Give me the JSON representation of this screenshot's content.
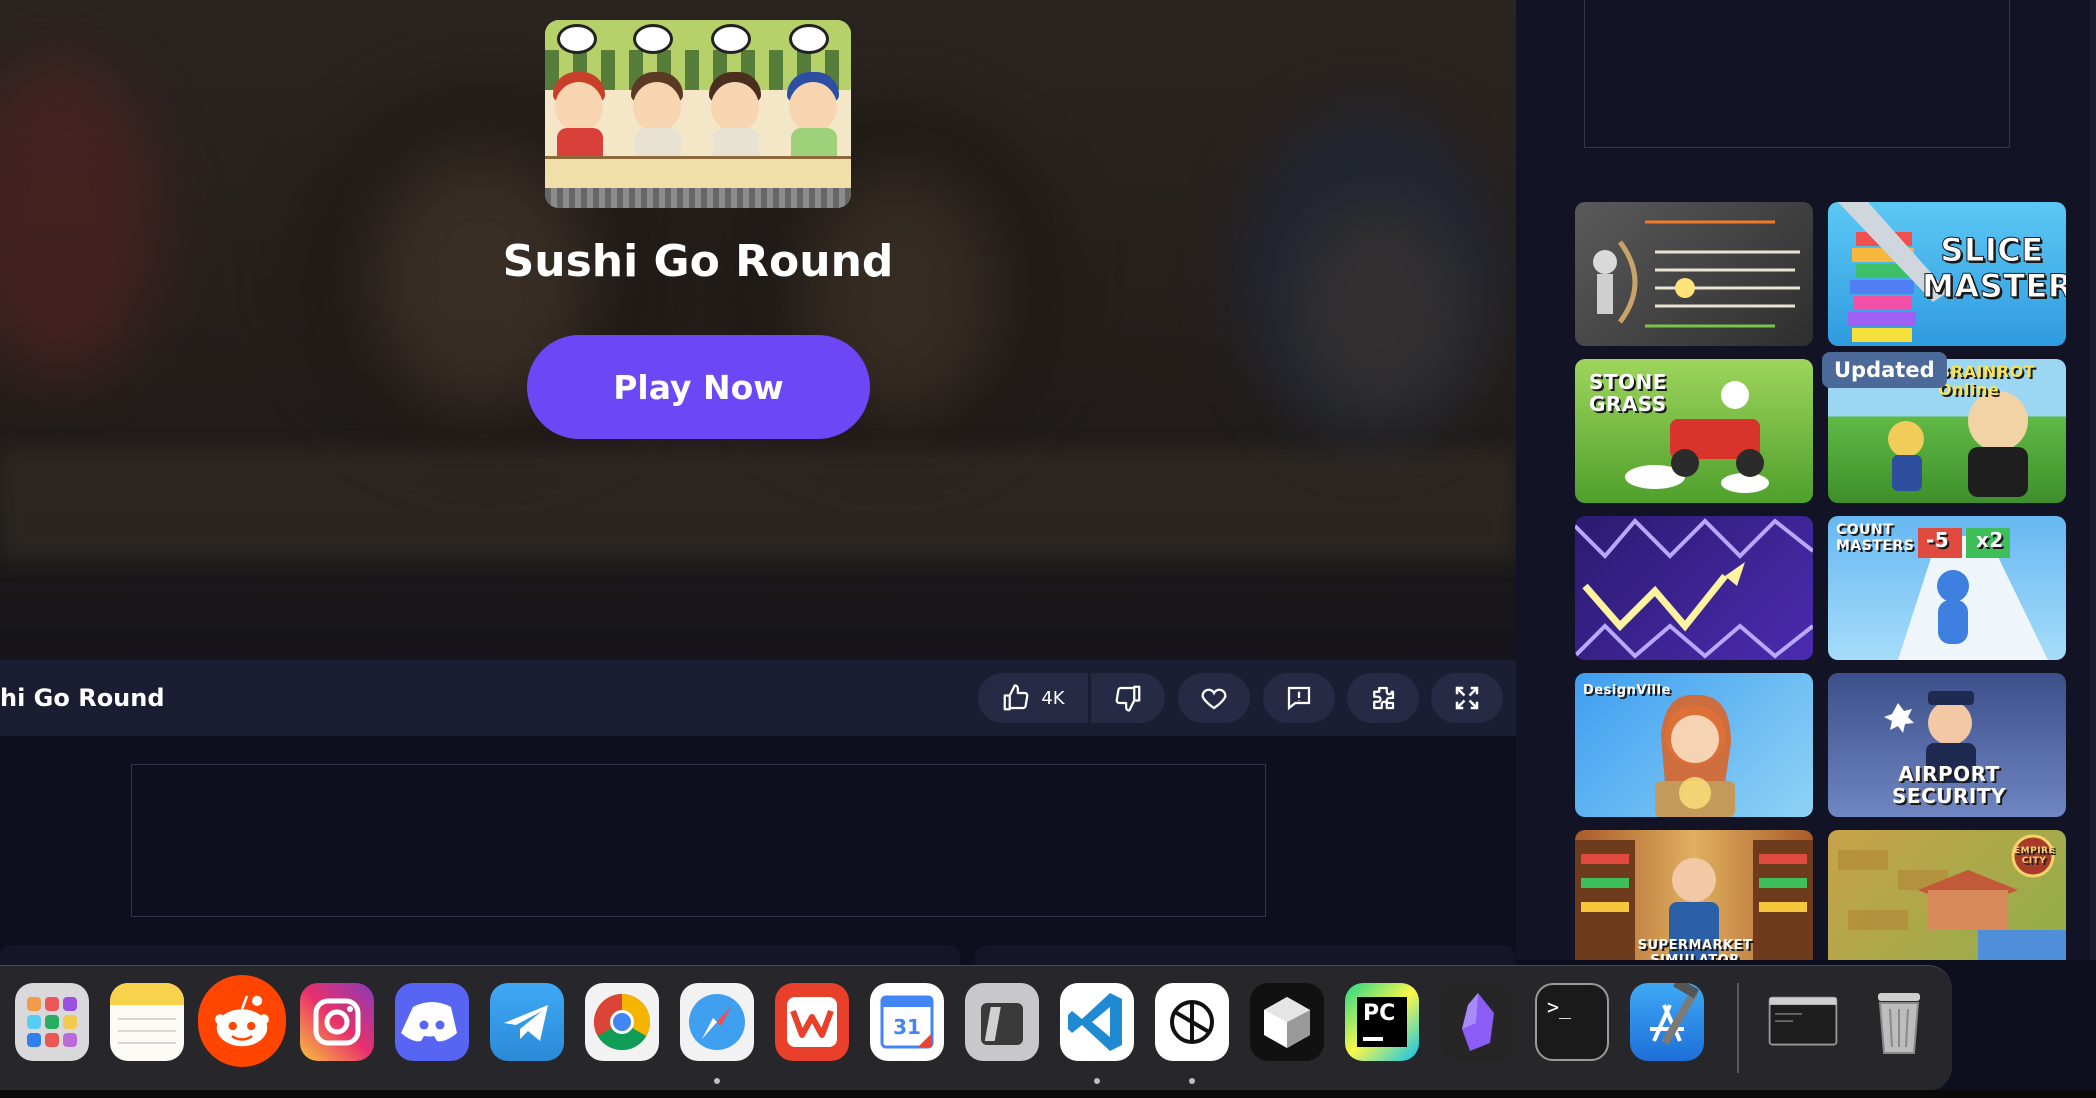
{
  "game": {
    "title": "Sushi Go Round",
    "play_label": "Play Now"
  },
  "gamebar": {
    "title": "hi Go Round",
    "likes": "4K"
  },
  "sidebar": {
    "updated_badge": "Updated",
    "tiles": [
      {
        "name": "archery-game",
        "label": ""
      },
      {
        "name": "slice-master",
        "label": "SLICE MASTER"
      },
      {
        "name": "stone-grass",
        "label": "STONE GRASS"
      },
      {
        "name": "brainrot-online",
        "label": "BRAINROT Online"
      },
      {
        "name": "geometry-wave",
        "label": ""
      },
      {
        "name": "count-masters",
        "label": "COUNT MASTERS"
      },
      {
        "name": "design-ville",
        "label": "DesignVille"
      },
      {
        "name": "airport-security",
        "label": "AIRPORT SECURITY"
      },
      {
        "name": "supermarket-simulator",
        "label": "SUPERMARKET SIMULATOR"
      },
      {
        "name": "empire-city",
        "label": "EMPIRE CITY"
      }
    ],
    "count_masters_tags": [
      "-5",
      "x2"
    ]
  },
  "dock": {
    "apps": [
      "Launchpad",
      "Notes",
      "Reddit",
      "Instagram",
      "Discord",
      "Telegram",
      "Chrome",
      "Safari",
      "WPS Office",
      "Google Calendar",
      "Parallels",
      "VS Code",
      "ChatGPT",
      "Unity",
      "PyCharm",
      "Obsidian",
      "Terminal",
      "Xcode",
      "Screen",
      "Trash"
    ],
    "calendar_day": "31",
    "pycharm_label": "PC",
    "terminal_label": ">_"
  },
  "colors": {
    "accent": "#6b47f5",
    "page_bg": "#0d0f1f",
    "bar_bg": "#1b1d33",
    "control_bg": "#272a45"
  }
}
